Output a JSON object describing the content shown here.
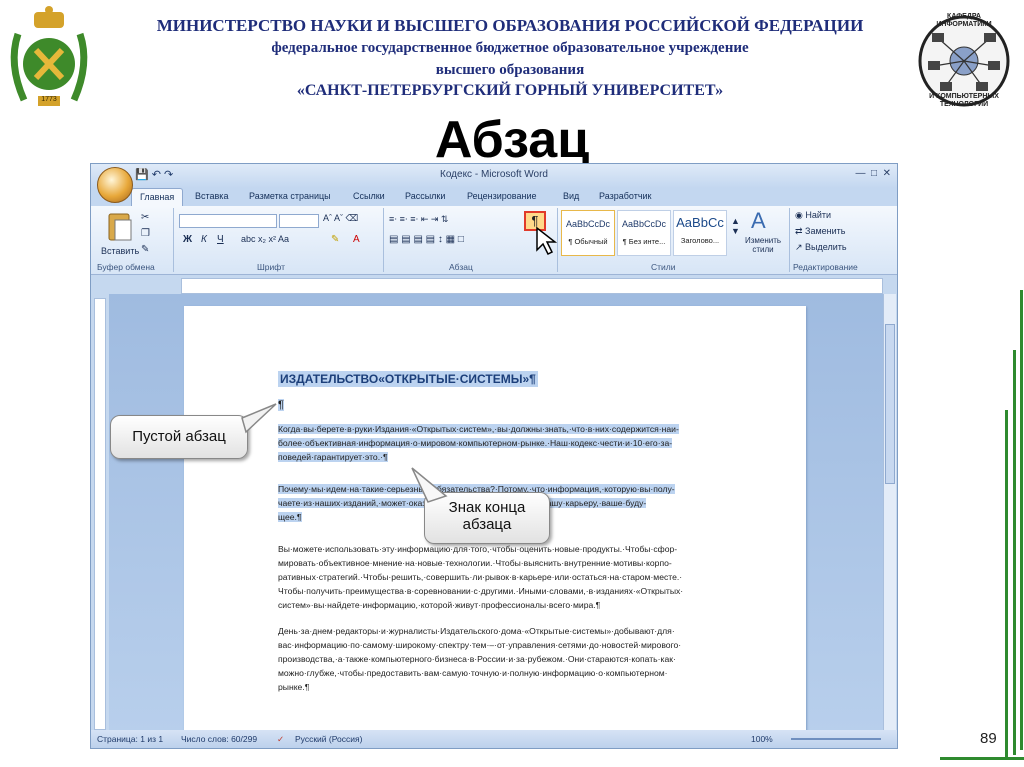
{
  "header": {
    "line1": "МИНИСТЕРСТВО НАУКИ И ВЫСШЕГО ОБРАЗОВАНИЯ РОССИЙСКОЙ ФЕДЕРАЦИИ",
    "line2": "федеральное государственное бюджетное образовательное учреждение",
    "line3": "высшего образования",
    "line4": "«САНКТ-ПЕТЕРБУРГСКИЙ ГОРНЫЙ УНИВЕРСИТЕТ»"
  },
  "emblem_left": {
    "year": "1773",
    "icon": "mining-university-emblem"
  },
  "emblem_right": {
    "top_line1": "КАФЕДРА",
    "top_line2": "ИНФОРМАТИКИ",
    "bottom_line1": "И КОМПЬЮТЕРНЫХ",
    "bottom_line2": "ТЕХНОЛОГИЙ",
    "icon": "network-globe-icon"
  },
  "slide_title": "Абзац",
  "word": {
    "window_title": "Кодекс - Microsoft Word",
    "tabs": [
      {
        "label": "Главная",
        "active": true
      },
      {
        "label": "Вставка"
      },
      {
        "label": "Разметка страницы"
      },
      {
        "label": "Ссылки"
      },
      {
        "label": "Рассылки"
      },
      {
        "label": "Рецензирование"
      },
      {
        "label": "Вид"
      },
      {
        "label": "Разработчик"
      }
    ],
    "ribbon": {
      "paste_label": "Вставить",
      "groups": [
        "Буфер обмена",
        "Шрифт",
        "Абзац",
        "Стили",
        "Редактирование"
      ],
      "styles": [
        {
          "sample": "AaBbCcDc",
          "name": "¶ Обычный"
        },
        {
          "sample": "AaBbCcDc",
          "name": "¶ Без инте..."
        },
        {
          "sample": "AaBbCc",
          "name": "Заголово..."
        }
      ],
      "change_styles": "Изменить стили",
      "find": "Найти",
      "replace": "Заменить",
      "select": "Выделить",
      "pilcrow": "¶"
    },
    "document": {
      "heading": "ИЗДАТЕЛЬСТВО«ОТКРЫТЫЕ·СИСТЕМЫ»¶",
      "empty_mark": "¶",
      "para1": [
        "Когда·вы·берете·в·руки·Издания·«Открытых·систем»,·вы·должны·знать,·что·в·них·содержится·наи-",
        "более·объективная·информация·о·мировом·компьютерном·рынке.·Наш·кодекс·чести·и·10·его·за-",
        "поведей·гарантирует·это.·¶"
      ],
      "para2": [
        "Почему·мы·идем·на·такие·серьезные·обязательства?·Потому,·что·информация,·которую·вы·полу-",
        "чаете·из·наших·изданий,·может·оказать·влияние·на·ваш·бизнес,·вашу·карьеру,·ваше·буду-",
        "щее.¶"
      ],
      "para3": [
        "Вы·можете·использовать·эту·информацию·для·того,·чтобы·оценить·новые·продукты.·Чтобы·сфор-",
        "мировать·объективное·мнение·на·новые·технологии.·Чтобы·выяснить·внутренние·мотивы·корпо-",
        "ративных·стратегий.·Чтобы·решить,·совершить·ли·рывок·в·карьере·или·остаться·на·старом·месте.·",
        "Чтобы·получить·преимущества·в·соревновании·с·другими.·Иными·словами,·в·изданиях·«Открытых·",
        "систем»·вы·найдете·информацию,·которой·живут·профессионалы·всего·мира.¶"
      ],
      "para4": [
        "День·за·днем·редакторы·и·журналисты·Издательского·дома·«Открытые·системы»·добывают·для·",
        "вас·информацию·по·самому·широкому·спектру·тем·–·от·управления·сетями·до·новостей·мирового·",
        "производства,·а·также·компьютерного·бизнеса·в·России·и·за·рубежом.·Они·стараются·копать·как·",
        "можно·глубже,·чтобы·предоставить·вам·самую·точную·и·полную·информацию·о·компьютерном·",
        "рынке.¶"
      ]
    },
    "status": {
      "page": "Страница: 1 из 1",
      "words": "Число слов: 60/299",
      "language": "Русский (Россия)",
      "zoom": "100%"
    }
  },
  "callouts": {
    "empty_paragraph": "Пустой абзац",
    "end_of_paragraph_line1": "Знак конца",
    "end_of_paragraph_line2": "абзаца"
  },
  "page_number": "89"
}
